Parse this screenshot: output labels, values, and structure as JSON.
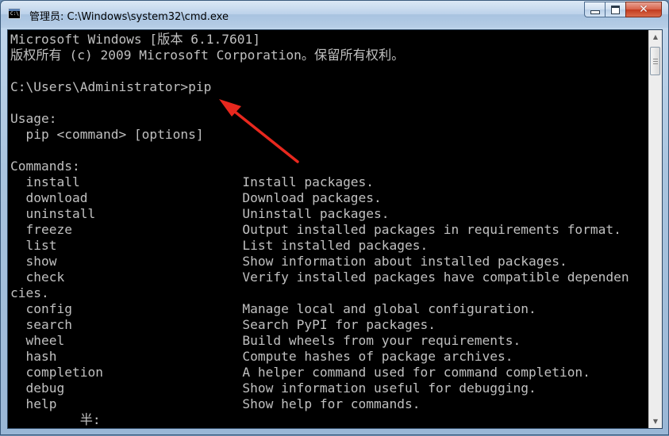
{
  "window": {
    "title": "管理员: C:\\Windows\\system32\\cmd.exe",
    "icon": "cmd-icon",
    "icon_text": "C:\\",
    "controls": {
      "minimize": "minimize-icon",
      "maximize": "maximize-icon",
      "close": "close-icon"
    }
  },
  "console": {
    "lines": [
      "Microsoft Windows [版本 6.1.7601]",
      "版权所有 (c) 2009 Microsoft Corporation。保留所有权利。",
      "",
      "C:\\Users\\Administrator>pip",
      "",
      "Usage:",
      "  pip <command> [options]",
      "",
      "Commands:",
      "  install                     Install packages.",
      "  download                    Download packages.",
      "  uninstall                   Uninstall packages.",
      "  freeze                      Output installed packages in requirements format.",
      "  list                        List installed packages.",
      "  show                        Show information about installed packages.",
      "  check                       Verify installed packages have compatible dependen",
      "cies.",
      "  config                      Manage local and global configuration.",
      "  search                      Search PyPI for packages.",
      "  wheel                       Build wheels from your requirements.",
      "  hash                        Compute hashes of package archives.",
      "  completion                  A helper command used for command completion.",
      "  debug                       Show information useful for debugging.",
      "  help                        Show help for commands.",
      "         半:"
    ]
  },
  "colors": {
    "console_background": "#000000",
    "console_text": "#c0c0c0",
    "annotation_arrow": "#e8281e"
  }
}
